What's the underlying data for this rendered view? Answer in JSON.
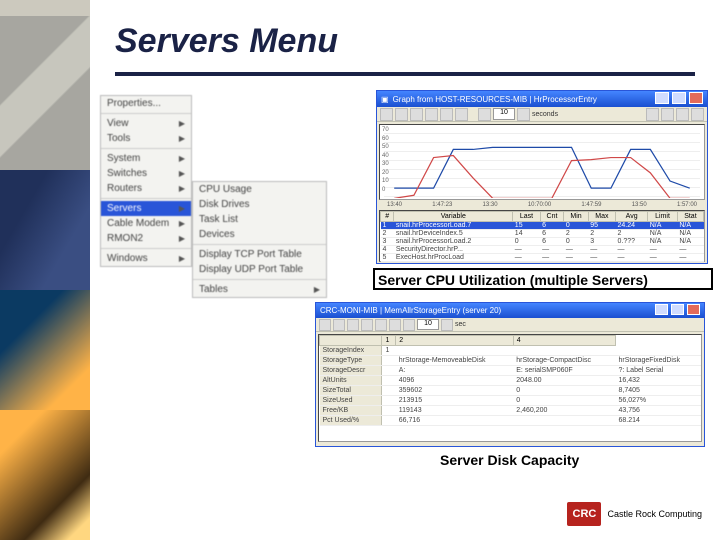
{
  "page": {
    "title": "Servers Menu"
  },
  "deco": true,
  "menu": {
    "col1": [
      {
        "label": "Properties..."
      },
      {
        "sep": true
      },
      {
        "label": "View",
        "sub": true
      },
      {
        "label": "Tools",
        "sub": true
      },
      {
        "sep": true
      },
      {
        "label": "System",
        "sub": true
      },
      {
        "label": "Switches",
        "sub": true
      },
      {
        "label": "Routers",
        "sub": true
      },
      {
        "sep": true
      },
      {
        "label": "Servers",
        "sub": true,
        "selected": true
      },
      {
        "label": "Cable Modem",
        "sub": true
      },
      {
        "label": "RMON2",
        "sub": true
      },
      {
        "sep": true
      },
      {
        "label": "Windows",
        "sub": true
      }
    ],
    "col2": [
      {
        "label": "CPU Usage"
      },
      {
        "label": "Disk Drives"
      },
      {
        "label": "Task List"
      },
      {
        "label": "Devices"
      },
      {
        "sep": true
      },
      {
        "label": "Display TCP Port Table"
      },
      {
        "label": "Display UDP Port Table"
      },
      {
        "sep": true
      },
      {
        "label": "Tables",
        "sub": true
      }
    ]
  },
  "win1": {
    "icon": "chart-icon",
    "title": "Graph from HOST-RESOURCES-MIB | HrProcessorEntry",
    "toolbar_text": "seconds",
    "caption": "Server CPU Utilization (multiple Servers)",
    "columns": [
      "#",
      "Variable",
      "Last",
      "Cnt",
      "Min",
      "Max",
      "Avg",
      "Limit",
      "Stat"
    ],
    "rows": [
      {
        "selected": true,
        "cells": [
          "1",
          "snail.hrProcessorLoad.7",
          "15",
          "6",
          "0",
          "95",
          "24.24",
          "N/A",
          "N/A"
        ]
      },
      {
        "cells": [
          "2",
          "snail.hrDeviceIndex.5",
          "14",
          "6",
          "2",
          "2",
          "2",
          "N/A",
          "N/A"
        ]
      },
      {
        "cells": [
          "3",
          "snail.hrProcessorLoad.2",
          "0",
          "6",
          "0",
          "3",
          "0.???",
          "N/A",
          "N/A"
        ]
      },
      {
        "cells": [
          "4",
          "SecurityDirector.hrP...",
          "—",
          "—",
          "—",
          "—",
          "—",
          "—",
          "—"
        ]
      },
      {
        "cells": [
          "5",
          "ExecHost.hrProcLoad",
          "—",
          "—",
          "—",
          "—",
          "—",
          "—",
          "—"
        ]
      }
    ]
  },
  "chart_data": {
    "type": "line",
    "title": "HrProcessorEntry",
    "ylim": [
      0,
      70
    ],
    "yticks": [
      0,
      10,
      20,
      30,
      40,
      50,
      60,
      70
    ],
    "x": [
      "13:40",
      "1:47:23",
      "13:30",
      "10:70:00",
      "1:47:59",
      "13:50",
      "1:57:00"
    ],
    "series": [
      {
        "name": "snail.hrProcessorLoad.7",
        "color": "#1e4aa8",
        "values": [
          10,
          10,
          10,
          48,
          48,
          50,
          50,
          50,
          50,
          50,
          10,
          10,
          48,
          48,
          17,
          10
        ]
      },
      {
        "name": "snail.hrProcessorLoad.2",
        "color": "#d04848",
        "values": [
          0,
          3,
          40,
          42,
          20,
          0,
          0,
          0,
          0,
          37,
          38,
          40,
          40,
          25,
          0,
          0
        ]
      }
    ]
  },
  "win2": {
    "icon": "table-icon",
    "title": "CRC-MONI-MIB | MemAllrStorageEntry (server 20)",
    "caption": "Server Disk Capacity",
    "columns": [
      "",
      "1",
      "2",
      "4"
    ],
    "rows": [
      {
        "label": "StorageIndex",
        "vals": [
          "1",
          "",
          "",
          ""
        ]
      },
      {
        "label": "StorageType",
        "vals": [
          "",
          "hrStorage-MemoveableDisk",
          "hrStorage-CompactDisc",
          "hrStorageFixedDisk"
        ]
      },
      {
        "label": "StorageDescr",
        "vals": [
          "",
          "A:",
          "E: serialSMP060F",
          "?: Label Serial"
        ]
      },
      {
        "label": "AltUnits",
        "vals": [
          "",
          "4096",
          "2048.00",
          "16,432"
        ]
      },
      {
        "label": "SizeTotal",
        "vals": [
          "",
          "359602",
          "0",
          "8,7405"
        ]
      },
      {
        "label": "SizeUsed",
        "vals": [
          "",
          "213915",
          "0",
          "56,027%"
        ]
      },
      {
        "label": "Free/KB",
        "vals": [
          "",
          "119143",
          "2,460,200",
          "43,756"
        ]
      },
      {
        "label": "Pct Used/%",
        "vals": [
          "",
          "66,716",
          "",
          "68.214"
        ]
      }
    ]
  },
  "footer": {
    "logo": "CRC",
    "text": "Castle Rock Computing"
  }
}
